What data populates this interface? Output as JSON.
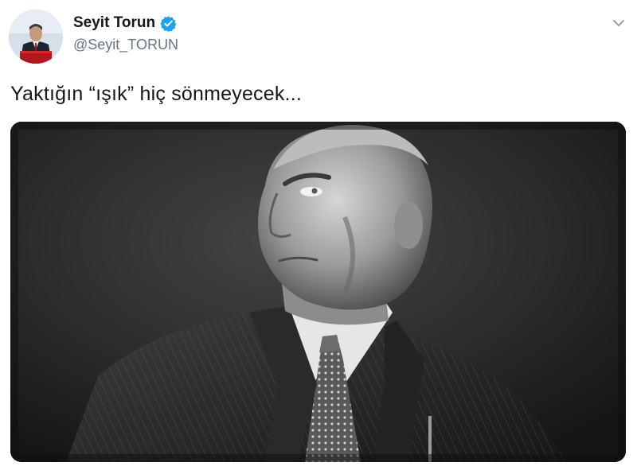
{
  "tweet": {
    "author": {
      "display_name": "Seyit Torun",
      "handle": "@Seyit_TORUN",
      "verified": true,
      "avatar_icon": "profile-photo"
    },
    "text": "Yaktığın “ışık” hiç sönmeyecek...",
    "menu_icon": "chevron-down-icon",
    "media": {
      "type": "photo",
      "style": "black-and-white portrait"
    },
    "colors": {
      "text": "#14171a",
      "secondary": "#657786",
      "verified": "#1da1f2"
    }
  }
}
